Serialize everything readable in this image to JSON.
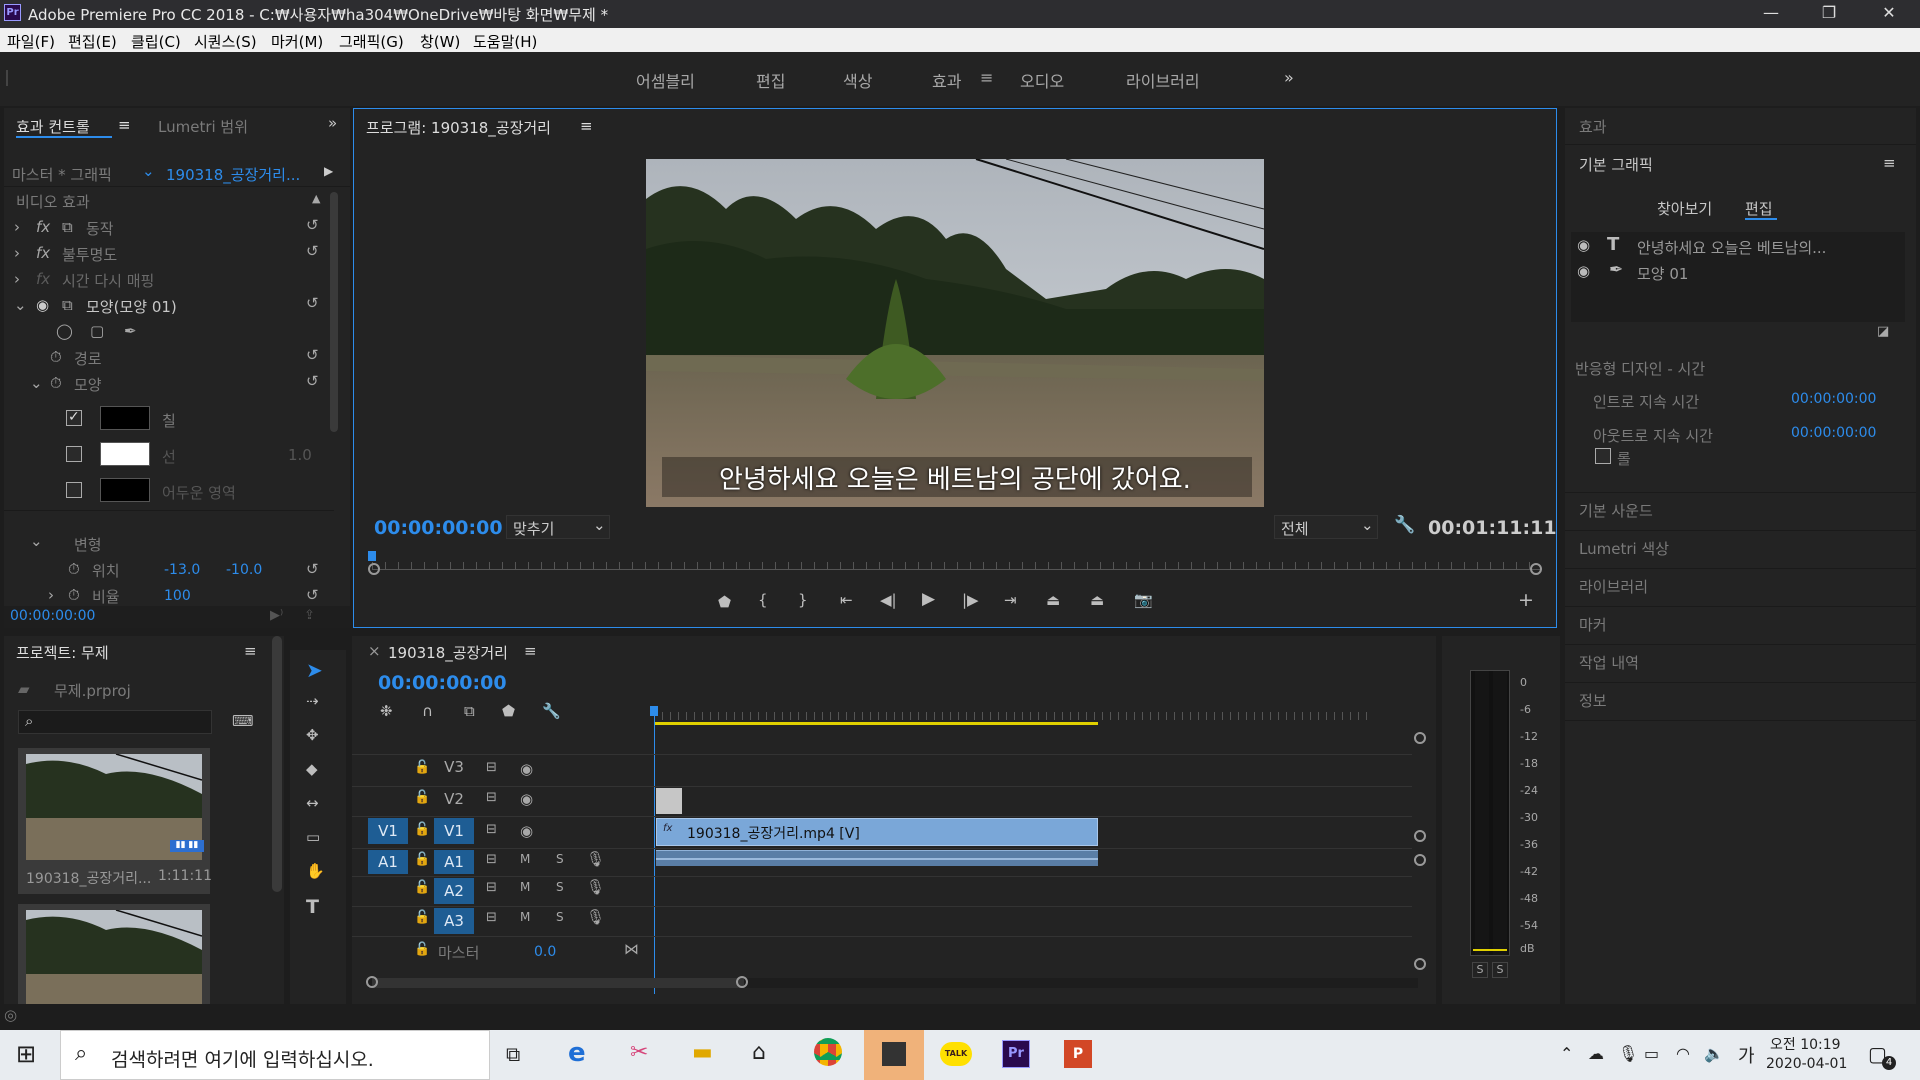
{
  "window": {
    "app_icon": "Pr",
    "title": "Adobe Premiere Pro CC 2018 - C:₩사용자₩ha304₩OneDrive₩바탕 화면₩무제 *",
    "minimize": "—",
    "restore": "❐",
    "close": "✕"
  },
  "menu": [
    "파일(F)",
    "편집(E)",
    "클립(C)",
    "시퀀스(S)",
    "마커(M)",
    "그래픽(G)",
    "창(W)",
    "도움말(H)"
  ],
  "workspaces": {
    "items": [
      "어셈블리",
      "편집",
      "색상",
      "효과",
      "오디오",
      "라이브러리"
    ],
    "active": "효과",
    "more": "»"
  },
  "effect_controls": {
    "tab_label": "효과 컨트롤",
    "lumetri_tab": "Lumetri 범위",
    "master": "마스터 * 그래픽",
    "clip": "190318_공장거리...",
    "section": "비디오 효과",
    "motion": "동작",
    "opacity": "불투명도",
    "time_remap": "시간 다시 매핑",
    "shape_layer": "모양(모양 01)",
    "path": "경로",
    "shape": "모양",
    "fill": "칠",
    "stroke": "선",
    "stroke_width": "1.0",
    "shadow": "어두운 영역",
    "transform": "변형",
    "position": "위치",
    "position_x": "-13.0",
    "position_y": "-10.0",
    "scale": "비율",
    "scale_value": "100",
    "timecode": "00:00:00:00",
    "fx": "fx"
  },
  "program": {
    "title": "프로그램: 190318_공장거리",
    "subtitle": "안녕하세요 오늘은  베트남의 공단에 갔어요.",
    "timecode": "00:00:00:00",
    "fit": "맞추기",
    "quality": "전체",
    "duration": "00:01:11:11"
  },
  "right_panel": {
    "effects": "효과",
    "essential_graphics": "기본 그래픽",
    "tabs": [
      "찾아보기",
      "편집"
    ],
    "active_tab": "편집",
    "layers": [
      {
        "icon": "text-layer-icon",
        "name": "안녕하세요 오늘은  베트남의..."
      },
      {
        "icon": "pen-layer-icon",
        "name": "모양 01"
      }
    ],
    "responsive_title": "반응형 디자인 - 시간",
    "intro_label": "인트로 지속 시간",
    "intro_value": "00:00:00:00",
    "outro_label": "아웃트로 지속 시간",
    "outro_value": "00:00:00:00",
    "roll_label": "롤",
    "panels": [
      "기본 사운드",
      "Lumetri 색상",
      "라이브러리",
      "마커",
      "작업 내역",
      "정보"
    ]
  },
  "project": {
    "title": "프로젝트: 무제",
    "file": "무제.prproj",
    "search_placeholder": "",
    "clip_name": "190318_공장거리...",
    "clip_duration": "1:11:11"
  },
  "timeline": {
    "close": "×",
    "title": "190318_공장거리",
    "timecode": "00:00:00:00",
    "tracks": [
      {
        "name": "V3",
        "patch": ""
      },
      {
        "name": "V2",
        "patch": ""
      },
      {
        "name": "V1",
        "patch": "V1"
      },
      {
        "name": "A1",
        "patch": "A1"
      },
      {
        "name": "A2",
        "patch": ""
      },
      {
        "name": "A3",
        "patch": ""
      }
    ],
    "master_label": "마스터",
    "master_value": "0.0",
    "clip_label": "190318_공장거리.mp4 [V]",
    "mute": "M",
    "solo": "S"
  },
  "audio_meter": {
    "scale": [
      "0",
      "-6",
      "-12",
      "-18",
      "-24",
      "-30",
      "-36",
      "-42",
      "-48",
      "-54",
      "dB"
    ],
    "solo_left": "S",
    "solo_right": "S"
  },
  "taskbar": {
    "search_placeholder": "검색하려면 여기에 입력하십시오.",
    "ime": "가",
    "time": "오전 10:19",
    "date": "2020-04-01",
    "notification_count": "4",
    "apps": [
      "task-view-icon",
      "edge-icon",
      "snip-icon",
      "explorer-icon",
      "store-icon",
      "chrome-icon",
      "sticky-notes-icon",
      "kakaotalk-icon",
      "premiere-icon",
      "powerpoint-icon"
    ],
    "kakao": "TALK",
    "premiere": "Pr",
    "powerpoint": "P"
  },
  "colors": {
    "accent": "#2d8ceb",
    "panel_bg": "#232323",
    "app_bg": "#1d1d1d",
    "clip_video": "#7aa7d8",
    "work_area": "#e0d000",
    "track_patch": "#1e5d94"
  }
}
